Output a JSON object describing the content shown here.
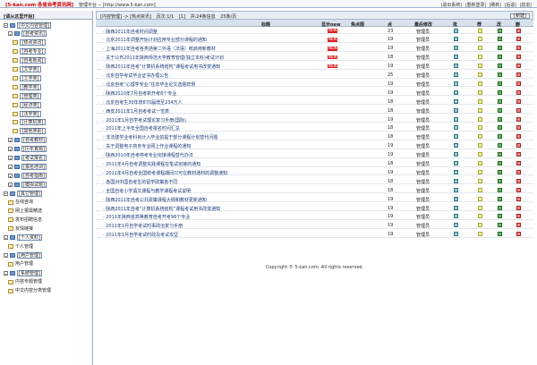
{
  "header": {
    "brand": "[5-kan.com 各省自考资讯网]",
    "site": "管理平台 -- [http://www.5-kan.com]",
    "links": [
      "|退出系统|",
      "|重新登录|",
      "|刷新|",
      "|后退|",
      "|前进|"
    ]
  },
  "sidebar": {
    "title": "[请从这里开始]",
    "items": [
      {
        "label": "[中文内容管理]",
        "icon": "folder-icon",
        "toggle": true,
        "style": "box",
        "depth": 0
      },
      {
        "label": "[自考资讯]",
        "icon": "folder-icon",
        "toggle": true,
        "style": "box",
        "depth": 1
      },
      {
        "label": "[热点资讯]",
        "icon": "page-icon",
        "style": "box",
        "depth": 2
      },
      {
        "label": "[自考专业]",
        "icon": "page-icon",
        "style": "box",
        "depth": 2
      },
      {
        "label": "[自考新闻]",
        "icon": "page-icon",
        "style": "box",
        "depth": 2
      },
      {
        "label": "[文学类]",
        "icon": "page-icon",
        "style": "box",
        "depth": 2
      },
      {
        "label": "[工学类]",
        "icon": "page-icon",
        "style": "box",
        "depth": 2
      },
      {
        "label": "[教学类]",
        "icon": "page-icon",
        "style": "box",
        "depth": 2
      },
      {
        "label": "[管理类]",
        "icon": "page-icon",
        "style": "box",
        "depth": 2
      },
      {
        "label": "[经济类]",
        "icon": "page-icon",
        "style": "box",
        "depth": 2
      },
      {
        "label": "[法学类]",
        "icon": "page-icon",
        "style": "box",
        "depth": 2
      },
      {
        "label": "[计算机类]",
        "icon": "page-icon",
        "style": "box",
        "depth": 2
      },
      {
        "label": "[其他类别]",
        "icon": "page-icon",
        "style": "box",
        "depth": 2
      },
      {
        "label": "[自考教材]",
        "icon": "folder-icon",
        "toggle": true,
        "style": "box",
        "depth": 1
      },
      {
        "label": "[历年真题]",
        "icon": "folder-icon",
        "toggle": true,
        "style": "box",
        "depth": 1
      },
      {
        "label": "[考试报名]",
        "icon": "folder-icon",
        "toggle": true,
        "style": "box",
        "depth": 1
      },
      {
        "label": "[报名培训]",
        "icon": "folder-icon",
        "toggle": true,
        "style": "box",
        "depth": 1
      },
      {
        "label": "[自考指南]",
        "icon": "folder-icon",
        "toggle": true,
        "style": "box",
        "depth": 1
      },
      {
        "label": "[模拟试题]",
        "icon": "folder-icon",
        "toggle": true,
        "style": "box",
        "depth": 1
      },
      {
        "label": "[其它管理]",
        "icon": "folder-icon",
        "toggle": true,
        "style": "box",
        "depth": 0
      },
      {
        "label": "在线咨询",
        "icon": "page-icon",
        "style": "plain",
        "depth": 1
      },
      {
        "label": "网上报需精选",
        "icon": "page-icon",
        "style": "plain",
        "depth": 1
      },
      {
        "label": "发布招聘信息",
        "icon": "page-icon",
        "style": "plain",
        "depth": 1
      },
      {
        "label": "友情链接",
        "icon": "page-icon",
        "style": "plain",
        "depth": 1
      },
      {
        "label": "[个人资料]",
        "icon": "folder-icon",
        "toggle": true,
        "style": "box",
        "depth": 0
      },
      {
        "label": "个人管理",
        "icon": "page-icon",
        "style": "plain",
        "depth": 1
      },
      {
        "label": "[用户管理]",
        "icon": "folder-icon",
        "toggle": true,
        "style": "box",
        "depth": 0
      },
      {
        "label": "用户管理",
        "icon": "page-icon",
        "style": "plain",
        "depth": 1
      },
      {
        "label": "[系统管理]",
        "icon": "folder-icon",
        "toggle": true,
        "style": "box",
        "depth": 0
      },
      {
        "label": "内容专题管理",
        "icon": "page-icon",
        "style": "plain",
        "depth": 1
      },
      {
        "label": "中文内容分类管理",
        "icon": "page-icon",
        "style": "plain",
        "depth": 1
      }
    ]
  },
  "breadcrumb": {
    "parts": [
      "[内容管理] -> [热点资讯]",
      "页次:1/1",
      "[1]",
      "共:24条信息",
      "25条/页"
    ],
    "new_label": "[新建]"
  },
  "table": {
    "columns": [
      "标题",
      "显示new",
      "焦点图",
      "点",
      "最后修改",
      "批",
      "荐",
      "改",
      "删"
    ],
    "rows": [
      {
        "title": "陕西2011年自考时间调整",
        "badge": "NEW",
        "clicks": "23",
        "editor": "管理员"
      },
      {
        "title": "北京2011年调整开始计划应用专业部分课程的通知",
        "badge": "NEW",
        "clicks": "19",
        "editor": "管理员"
      },
      {
        "title": "上海2011年自考各类通第二外语（法语）统启用新教材",
        "badge": "NEW",
        "clicks": "19",
        "editor": "管理员"
      },
      {
        "title": "关于公布2011年陕西师范大学教育管理(独立本科)考试计划",
        "badge": "NEW",
        "clicks": "18",
        "editor": "管理员"
      },
      {
        "title": "陕西2011年自考“计算机系统结构”课程考试用书改变通知",
        "badge": "NEW",
        "clicks": "19",
        "editor": "管理员"
      },
      {
        "title": "北京自学考试毕业证书办理公告",
        "badge": "",
        "clicks": "25",
        "editor": "管理员"
      },
      {
        "title": "北京自考“心理学专业”往年毕业论文选题样例",
        "badge": "",
        "clicks": "19",
        "editor": "管理员"
      },
      {
        "title": "陕西2010年7月自考新开考8个专业",
        "badge": "",
        "clicks": "19",
        "editor": "管理员"
      },
      {
        "title": "北京自考生30年增870届增至234万人",
        "badge": "",
        "clicks": "18",
        "editor": "管理员"
      },
      {
        "title": "西安2011年1月自考考试一览表",
        "badge": "",
        "clicks": "18",
        "editor": "管理员"
      },
      {
        "title": "2011年1月自学考试理论复习手册(国际)",
        "badge": "",
        "clicks": "19",
        "editor": "管理员"
      },
      {
        "title": "2011年上半年全国自考报名时间汇总",
        "badge": "",
        "clicks": "18",
        "editor": "管理员"
      },
      {
        "title": "非法建学业考科目计入毕业前提于部分课程计划替代问题",
        "badge": "",
        "clicks": "18",
        "editor": "管理员"
      },
      {
        "title": "关于调整电子商务专业网上作业课程的通知",
        "badge": "",
        "clicks": "19",
        "editor": "管理员"
      },
      {
        "title": "陕西2010年自考停考专业衔接课程替代办法",
        "badge": "",
        "clicks": "19",
        "editor": "管理员"
      },
      {
        "title": "2011年4月自考调整实践课程在笔试衔接的通知",
        "badge": "",
        "clicks": "18",
        "editor": "管理员"
      },
      {
        "title": "2011年4月自考全国统考课程期间只可在教材通材的调整通知",
        "badge": "",
        "clicks": "19",
        "editor": "管理员"
      },
      {
        "title": "各国对中国自考生的留学政策各不同",
        "badge": "",
        "clicks": "18",
        "editor": "管理员"
      },
      {
        "title": "全国自考小学语文课程与教学课程考试说明",
        "badge": "",
        "clicks": "18",
        "editor": "管理员"
      },
      {
        "title": "陕西2011年自考公共政策课程大纲和教材更新通知",
        "badge": "",
        "clicks": "19",
        "editor": "管理员"
      },
      {
        "title": "陕西2011年自考“计算机系统结构”课程考试用书改变通知",
        "badge": "",
        "clicks": "19",
        "editor": "管理员"
      },
      {
        "title": "2011年陕西省高等教育自考开考96个专业",
        "badge": "",
        "clicks": "19",
        "editor": "管理员"
      },
      {
        "title": "2011年1月自学考试时事政治复习手册",
        "badge": "",
        "clicks": "19",
        "editor": "管理员"
      },
      {
        "title": "2011年1月自学考试时政及考试攻坚",
        "badge": "",
        "clicks": "19",
        "editor": "管理员"
      }
    ]
  },
  "footer": {
    "copyright": "Copyright © 5-kan.com. All rights reserved."
  }
}
